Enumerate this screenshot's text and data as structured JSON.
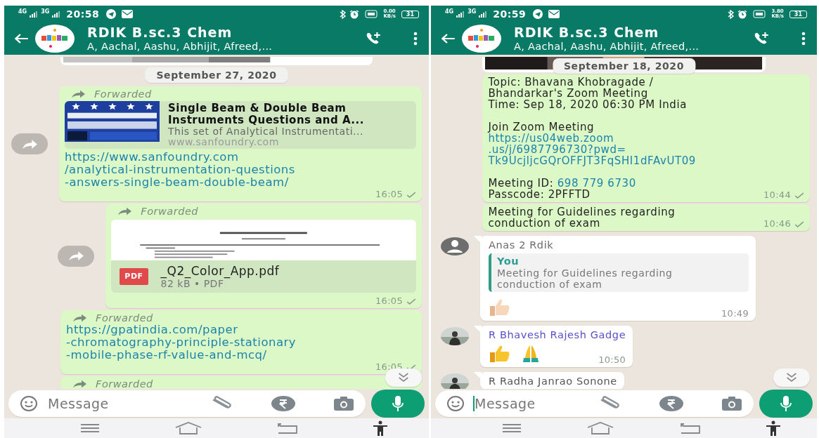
{
  "phones": [
    {
      "status_bar": {
        "networks": [
          "4G",
          "3G"
        ],
        "time": "20:58",
        "speed": "0.00",
        "speed_unit": "KB/s",
        "battery": "31"
      },
      "header": {
        "title": "RDIK B.sc.3 Chem",
        "subtitle": "A, Aachal, Aashu, Abhijit, Afreed,..."
      },
      "messages": [
        {
          "kind": "media"
        },
        {
          "kind": "date",
          "text": "September 27, 2020"
        },
        {
          "kind": "link_preview",
          "forwarded": "Forwarded",
          "share_button": true,
          "preview": {
            "title": "Single Beam & Double Beam\nInstruments Questions and A...",
            "description": "This set of Analytical Instrumentati...",
            "site": "www.sanfoundry.com"
          },
          "link": "https://www.sanfoundry.com\n/analytical-instrumentation-questions\n-answers-single-beam-double-beam/",
          "time": "16:05",
          "sent": true
        },
        {
          "kind": "document",
          "forwarded": "Forwarded",
          "share_button": true,
          "file_type": "PDF",
          "file_name": "_Q2_Color_App.pdf",
          "file_meta": "82 kB • PDF",
          "time": "16:05",
          "sent": true
        },
        {
          "kind": "link",
          "forwarded": "Forwarded",
          "link": "https://gpatindia.com/paper\n-chromatography-principle-stationary\n-mobile-phase-rf-value-and-mcq/",
          "time": "16:05",
          "sent": true
        },
        {
          "kind": "link",
          "forwarded": "Forwarded"
        }
      ],
      "composer": {
        "placeholder": "Message",
        "focused": false
      }
    },
    {
      "status_bar": {
        "networks": [
          "4G",
          "3G"
        ],
        "time": "20:59",
        "speed": "3.80",
        "speed_unit": "KB/s",
        "battery": "31"
      },
      "header": {
        "title": "RDIK B.sc.3 Chem",
        "subtitle": "A, Aachal, Aashu, Abhijit, Afreed,..."
      },
      "messages": [
        {
          "kind": "media",
          "date": "September 18, 2020"
        },
        {
          "kind": "text",
          "groups": [
            [
              {
                "text": "Topic: Bhavana Khobragade /\nBhandarkar's Zoom Meeting\nTime: Sep 18, 2020 06:30 PM India"
              }
            ],
            [
              {
                "text": "Join Zoom Meeting"
              },
              {
                "link": "https://us04web.zoom\n.us/j/6987796730?pwd=\nTk9UcjljcGQrOFFJT3FqSHI1dFAvUT09"
              }
            ],
            [
              {
                "text": "Meeting ID: ",
                "link": "698 779 6730"
              },
              {
                "text": "Passcode: 2PFFTD"
              }
            ]
          ],
          "time": "10:44",
          "sent": true
        },
        {
          "kind": "text",
          "groups": [
            [
              {
                "text": "Meeting for Guidelines regarding\nconduction of exam"
              }
            ]
          ],
          "time": "10:46",
          "sent": true
        },
        {
          "kind": "incoming",
          "avatar": {
            "kind": "default"
          },
          "sender": "Anas 2 Rdik",
          "color": "#6b6b6b",
          "quote": {
            "author": "You",
            "text": "Meeting for Guidelines regarding\nconduction of exam"
          },
          "reactions": [
            {
              "kind": "thumbs_up_light"
            }
          ],
          "time": "10:49"
        },
        {
          "kind": "incoming",
          "avatar": {
            "kind": "picture"
          },
          "sender": "R Bhavesh Rajesh Gadge",
          "color": "#5a4fc9",
          "reactions": [
            {
              "kind": "thumbs_up"
            },
            {
              "kind": "praying_hands"
            }
          ],
          "time": "10:50"
        },
        {
          "kind": "incoming",
          "avatar": {
            "kind": "picture"
          },
          "sender": "R Radha Janrao Sonone",
          "color": "#555555"
        }
      ],
      "composer": {
        "placeholder": "Message",
        "focused": true
      }
    }
  ]
}
